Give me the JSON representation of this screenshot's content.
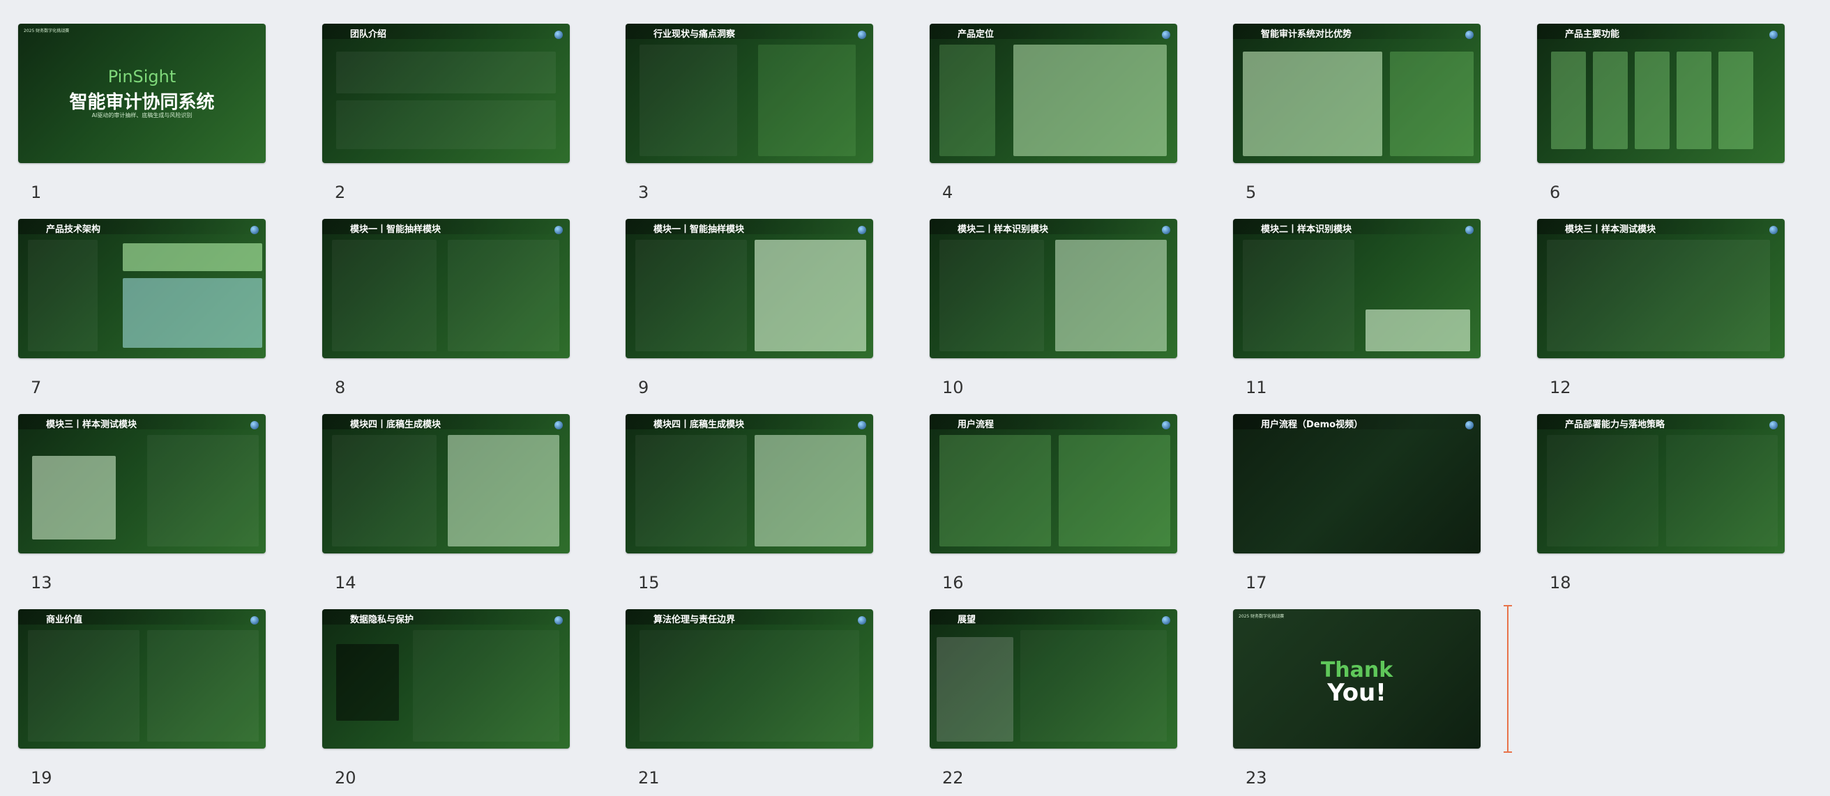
{
  "slides": [
    {
      "n": "1",
      "title": "",
      "brand": "PinSight",
      "big_title": "智能审计协同系统",
      "subtitle": "AI驱动的审计抽样、底稿生成与风险识别",
      "tag": "2025 财务数字化挑战赛"
    },
    {
      "n": "2",
      "title": "团队介绍"
    },
    {
      "n": "3",
      "title": "行业现状与痛点洞察"
    },
    {
      "n": "4",
      "title": "产品定位"
    },
    {
      "n": "5",
      "title": "智能审计系统对比优势"
    },
    {
      "n": "6",
      "title": "产品主要功能"
    },
    {
      "n": "7",
      "title": "产品技术架构"
    },
    {
      "n": "8",
      "title": "模块一丨智能抽样模块"
    },
    {
      "n": "9",
      "title": "模块一丨智能抽样模块"
    },
    {
      "n": "10",
      "title": "模块二丨样本识别模块"
    },
    {
      "n": "11",
      "title": "模块二丨样本识别模块"
    },
    {
      "n": "12",
      "title": "模块三丨样本测试模块"
    },
    {
      "n": "13",
      "title": "模块三丨样本测试模块"
    },
    {
      "n": "14",
      "title": "模块四丨底稿生成模块"
    },
    {
      "n": "15",
      "title": "模块四丨底稿生成模块"
    },
    {
      "n": "16",
      "title": "用户流程"
    },
    {
      "n": "17",
      "title": "用户流程（Demo视频）"
    },
    {
      "n": "18",
      "title": "产品部署能力与落地策略"
    },
    {
      "n": "19",
      "title": "商业价值"
    },
    {
      "n": "20",
      "title": "数据隐私与保护"
    },
    {
      "n": "21",
      "title": "算法伦理与责任边界"
    },
    {
      "n": "22",
      "title": "展望"
    },
    {
      "n": "23",
      "title": "",
      "thank": "Thank",
      "you": "You!",
      "tag": "2025 财务数字化挑战赛"
    }
  ]
}
